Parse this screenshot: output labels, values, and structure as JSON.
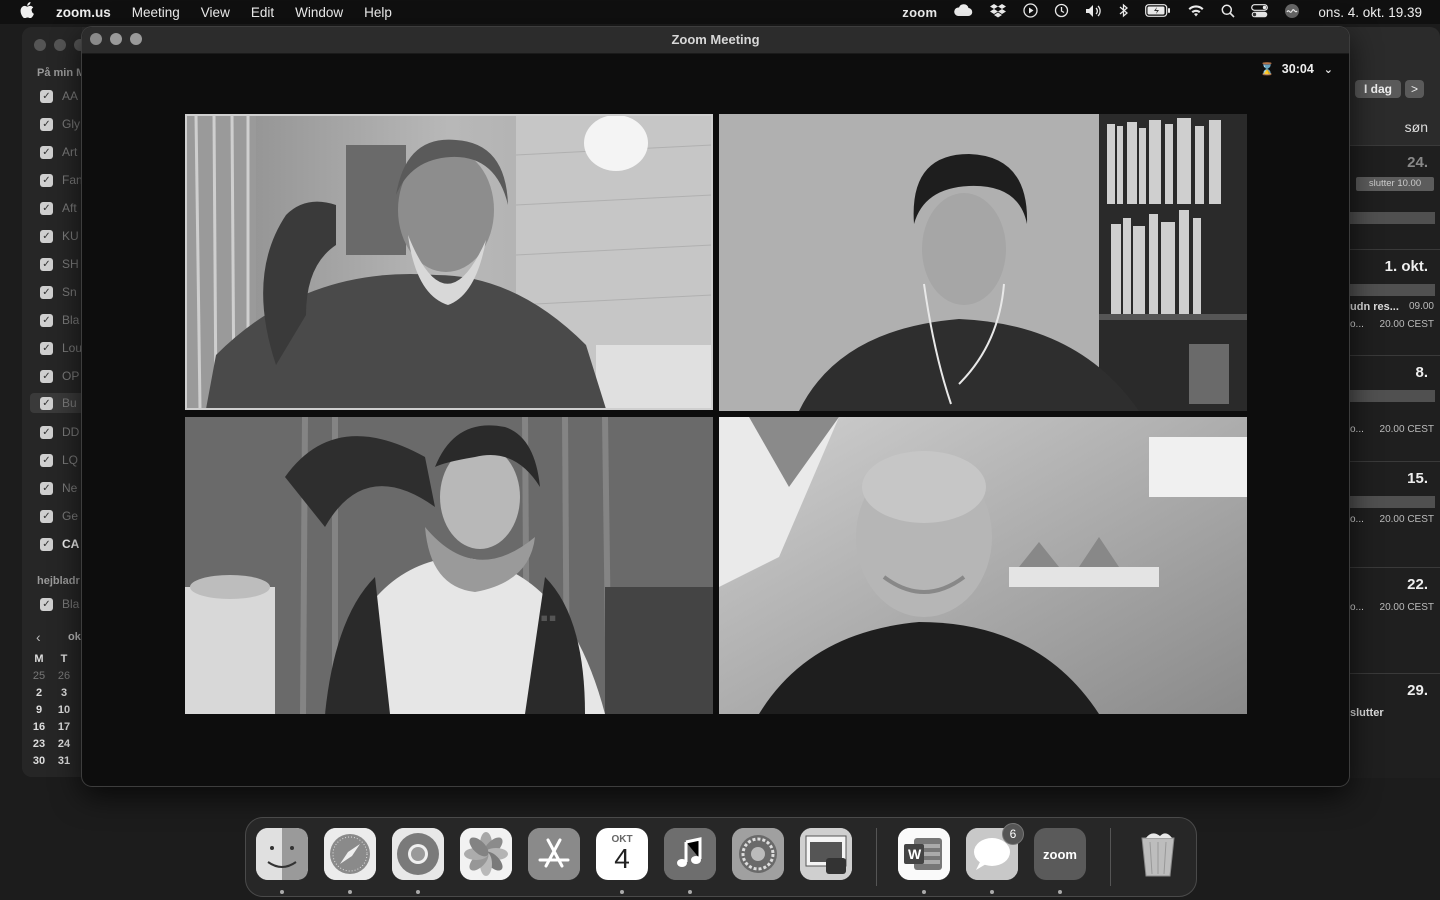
{
  "menubar": {
    "app": "zoom.us",
    "items": [
      "Meeting",
      "View",
      "Edit",
      "Window",
      "Help"
    ],
    "zoom_status": "zoom",
    "clock": "ons. 4. okt. 19.39"
  },
  "calendar": {
    "section_mine": "På min M",
    "calendars": [
      {
        "label": "AA",
        "checked": true
      },
      {
        "label": "Gly",
        "checked": true
      },
      {
        "label": "Art",
        "checked": true
      },
      {
        "label": "Fan",
        "checked": true
      },
      {
        "label": "Aft",
        "checked": true
      },
      {
        "label": "KU",
        "checked": true
      },
      {
        "label": "SH",
        "checked": true
      },
      {
        "label": "Sn",
        "checked": true
      },
      {
        "label": "Bla",
        "checked": true
      },
      {
        "label": "Lou",
        "checked": true
      },
      {
        "label": "OP",
        "checked": true
      },
      {
        "label": "Bu",
        "checked": true
      },
      {
        "label": "DD",
        "checked": true
      },
      {
        "label": "LQ",
        "checked": true
      },
      {
        "label": "Ne",
        "checked": true
      },
      {
        "label": "Ge",
        "checked": true
      },
      {
        "label": "CA",
        "checked": true
      }
    ],
    "section_other": "hejbladr",
    "other_calendars": [
      {
        "label": "Bla",
        "checked": true
      }
    ],
    "mini_month": "ok",
    "mini_headers": [
      "M",
      "T"
    ],
    "mini_rows": [
      [
        "25",
        "26"
      ],
      [
        "2",
        "3"
      ],
      [
        "9",
        "10"
      ],
      [
        "16",
        "17"
      ],
      [
        "23",
        "24"
      ],
      [
        "30",
        "31"
      ]
    ],
    "today_label": "I dag",
    "next_label": ">",
    "day_name": "søn",
    "weeks": [
      {
        "num": "24.",
        "pill": "slutter 10.00"
      },
      {
        "num": "1. okt.",
        "event_title": "udn res...",
        "event_time": "09.00",
        "event2_title": "o...",
        "event2_time": "20.00 CEST"
      },
      {
        "num": "8.",
        "event2_title": "o...",
        "event2_time": "20.00 CEST"
      },
      {
        "num": "15.",
        "event2_title": "o...",
        "event2_time": "20.00 CEST"
      },
      {
        "num": "22.",
        "event2_title": "o...",
        "event2_time": "20.00 CEST"
      },
      {
        "num": "29.",
        "event_title": "slutter"
      }
    ]
  },
  "zoom": {
    "window_title": "Zoom Meeting",
    "timer": "30:04",
    "participants": [
      {
        "tile": "top-left",
        "active": true
      },
      {
        "tile": "top-right",
        "active": false
      },
      {
        "tile": "bottom-left",
        "active": false
      },
      {
        "tile": "bottom-right",
        "active": false
      }
    ]
  },
  "dock": {
    "apps": [
      "finder-icon",
      "safari-icon",
      "chrome-icon",
      "photos-icon",
      "app-store-icon",
      "calendar-icon",
      "music-icon",
      "system-settings-icon",
      "preview-icon",
      "word-icon",
      "messages-icon",
      "zoom-icon",
      "trash-icon"
    ],
    "calendar_month": "OKT",
    "calendar_day": "4",
    "messages_badge": "6",
    "zoom_label": "zoom",
    "word_letter": "W"
  }
}
